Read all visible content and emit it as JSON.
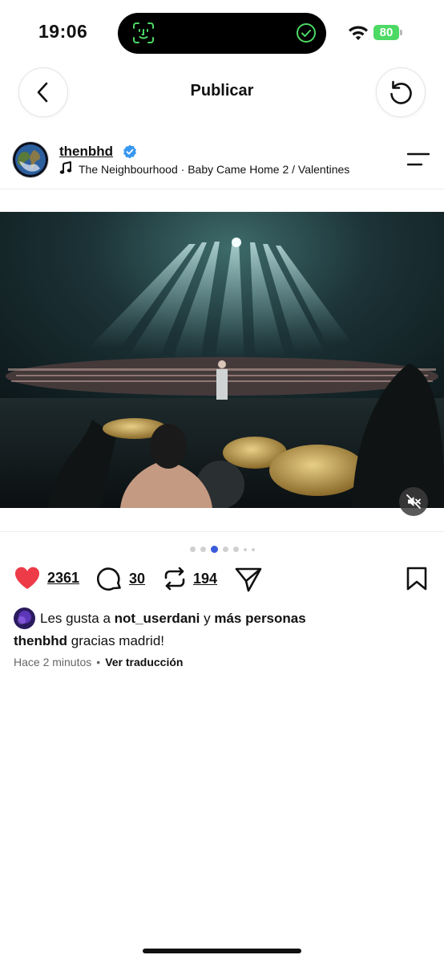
{
  "status_bar": {
    "time": "19:06",
    "battery": "80"
  },
  "header": {
    "title": "Publicar"
  },
  "post": {
    "username": "thenbhd",
    "track": "The Neighbourhood · Baby Came Home 2 / Valentines",
    "likes": "2361",
    "comments": "30",
    "reposts": "194",
    "likes_prefix": "Les gusta a",
    "liked_by": "not_userdani",
    "likes_join": "y",
    "likes_others": "más personas",
    "caption_user": "thenbhd",
    "caption_text": "gracias madrid!",
    "time_ago": "Hace 2 minutos",
    "separator": "•",
    "translate": "Ver traducción",
    "carousel": {
      "count": 7,
      "active": 2
    }
  },
  "colors": {
    "like": "#ed3b48",
    "verified": "#3897f0",
    "battery": "#4cd964",
    "faceid": "#4cd964",
    "active_dot": "#3b5bdb"
  },
  "icons": [
    "back-icon",
    "refresh-icon",
    "verified-icon",
    "music-note-icon",
    "menu-icon",
    "mute-icon",
    "heart-icon",
    "comment-icon",
    "repost-icon",
    "share-icon",
    "bookmark-icon"
  ]
}
